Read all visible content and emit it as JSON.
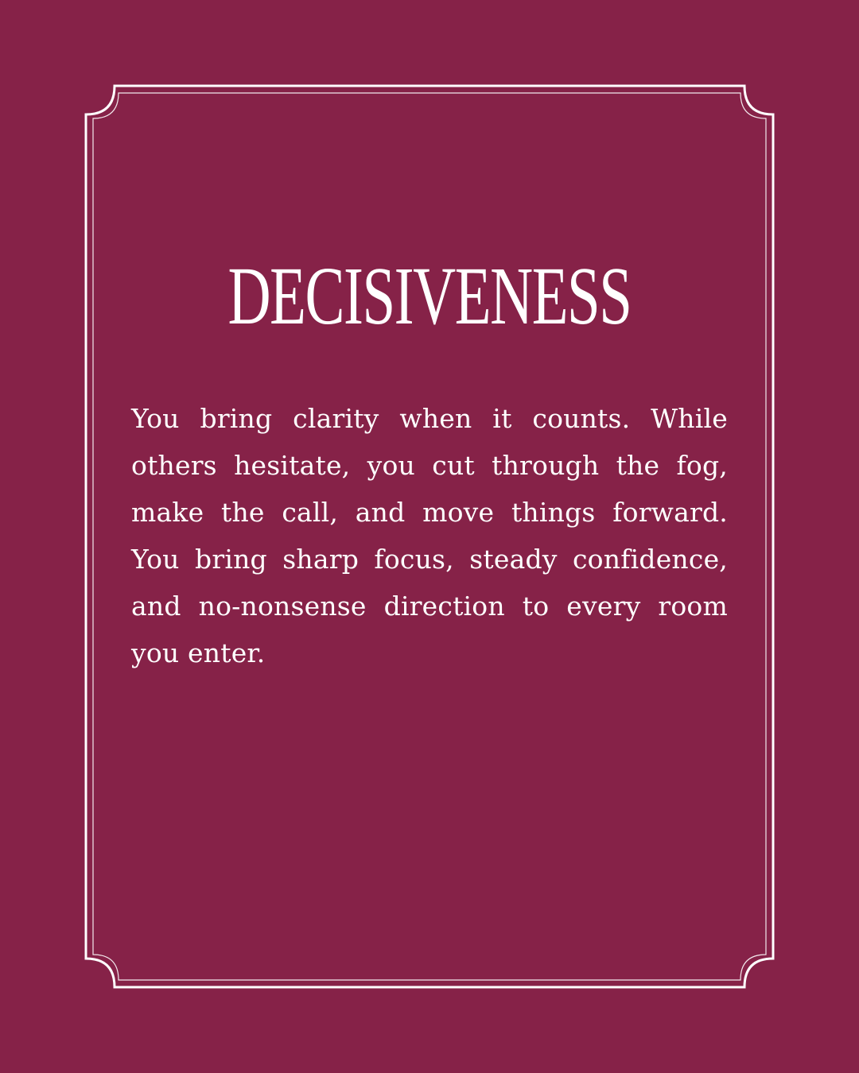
{
  "card": {
    "title": "DECISIVENESS",
    "body": "You bring clarity when it counts. While others hesitate, you cut through the fog, make the call, and move things forward. You bring sharp focus, steady confidence, and no-nonsense direction to every room you enter."
  },
  "colors": {
    "background": "#862248",
    "frame": "#ffffff",
    "text": "#ffffff"
  }
}
